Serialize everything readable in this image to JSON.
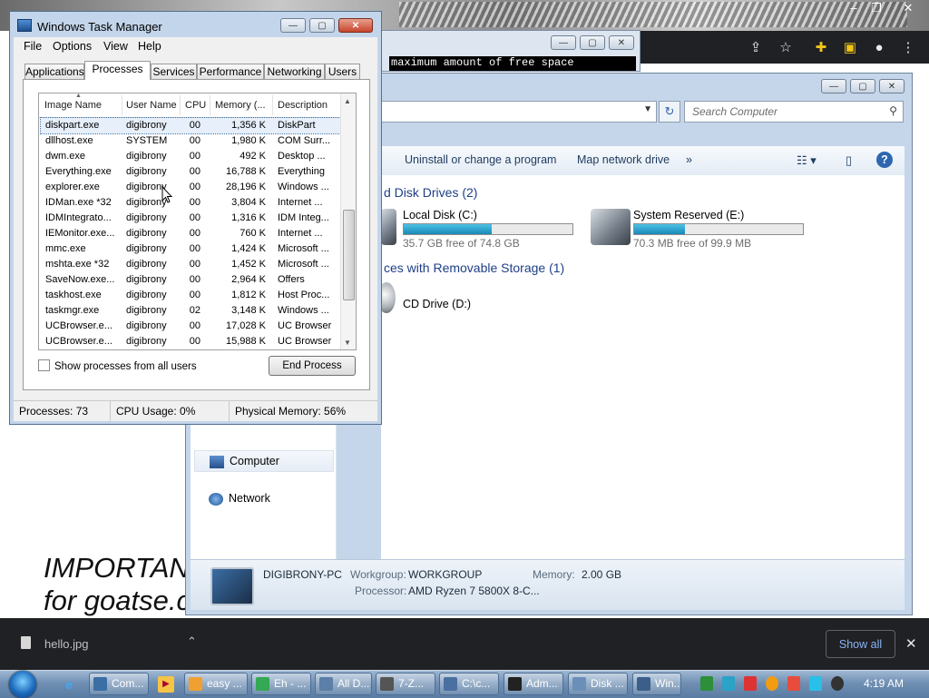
{
  "background": {
    "cmd_text": "maximum amount of free space",
    "important_line1": "IMPORTAN",
    "important_line2": "for goatse.c"
  },
  "explorer": {
    "search_placeholder": "Search Computer",
    "cmdbar": {
      "uninstall": "Uninstall or change a program",
      "map_drive": "Map network drive",
      "more": "»"
    },
    "sections": {
      "hard_drives": "d Disk Drives (2)",
      "removable": "ces with Removable Storage (1)"
    },
    "drives": [
      {
        "name": "Local Disk (C:)",
        "free": "35.7 GB free of 74.8 GB",
        "used_fraction": 0.52
      },
      {
        "name": "System Reserved (E:)",
        "free": "70.3 MB free of 99.9 MB",
        "used_fraction": 0.3
      }
    ],
    "cd_drive": "CD Drive (D:)",
    "nav": {
      "computer": "Computer",
      "network": "Network"
    },
    "details": {
      "pc_name": "DIGIBRONY-PC",
      "workgroup_label": "Workgroup:",
      "workgroup": "WORKGROUP",
      "memory_label": "Memory:",
      "memory": "2.00 GB",
      "processor_label": "Processor:",
      "processor": "AMD Ryzen 7 5800X 8-C..."
    }
  },
  "task_manager": {
    "title": "Windows Task Manager",
    "menu": [
      "File",
      "Options",
      "View",
      "Help"
    ],
    "tabs": [
      "Applications",
      "Processes",
      "Services",
      "Performance",
      "Networking",
      "Users"
    ],
    "active_tab": "Processes",
    "columns": [
      "Image Name",
      "User Name",
      "CPU",
      "Memory (...",
      "Description"
    ],
    "processes": [
      [
        "diskpart.exe",
        "digibrony",
        "00",
        "1,356 K",
        "DiskPart"
      ],
      [
        "dllhost.exe",
        "SYSTEM",
        "00",
        "1,980 K",
        "COM Surr..."
      ],
      [
        "dwm.exe",
        "digibrony",
        "00",
        "492 K",
        "Desktop ..."
      ],
      [
        "Everything.exe",
        "digibrony",
        "00",
        "16,788 K",
        "Everything"
      ],
      [
        "explorer.exe",
        "digibrony",
        "00",
        "28,196 K",
        "Windows ..."
      ],
      [
        "IDMan.exe *32",
        "digibrony",
        "00",
        "3,804 K",
        "Internet ..."
      ],
      [
        "IDMIntegrato...",
        "digibrony",
        "00",
        "1,316 K",
        "IDM Integ..."
      ],
      [
        "IEMonitor.exe...",
        "digibrony",
        "00",
        "760 K",
        "Internet ..."
      ],
      [
        "mmc.exe",
        "digibrony",
        "00",
        "1,424 K",
        "Microsoft ..."
      ],
      [
        "mshta.exe *32",
        "digibrony",
        "00",
        "1,452 K",
        "Microsoft ..."
      ],
      [
        "SaveNow.exe...",
        "digibrony",
        "00",
        "2,964 K",
        "Offers"
      ],
      [
        "taskhost.exe",
        "digibrony",
        "00",
        "1,812 K",
        "Host Proc..."
      ],
      [
        "taskmgr.exe",
        "digibrony",
        "02",
        "3,148 K",
        "Windows ..."
      ],
      [
        "UCBrowser.e...",
        "digibrony",
        "00",
        "17,028 K",
        "UC Browser"
      ],
      [
        "UCBrowser.e...",
        "digibrony",
        "00",
        "15,988 K",
        "UC Browser"
      ]
    ],
    "show_all_label": "Show processes from all users",
    "end_process_label": "End Process",
    "status": {
      "processes": "Processes: 73",
      "cpu": "CPU Usage: 0%",
      "memory": "Physical Memory: 56%"
    }
  },
  "download_bar": {
    "filename": "hello.jpg",
    "show_all": "Show all"
  },
  "taskbar": {
    "items": [
      "Com...",
      "easy ...",
      "Eh - ...",
      "All D...",
      "7-Z...",
      "C:\\c...",
      "Adm...",
      "Disk ...",
      "Win..."
    ],
    "clock": "4:19 AM"
  },
  "colors": {
    "selection": "#e6effa",
    "section_heading": "#1e3f87",
    "drive_fill": "#26a3d4",
    "show_all_text": "#8ab4f8"
  }
}
